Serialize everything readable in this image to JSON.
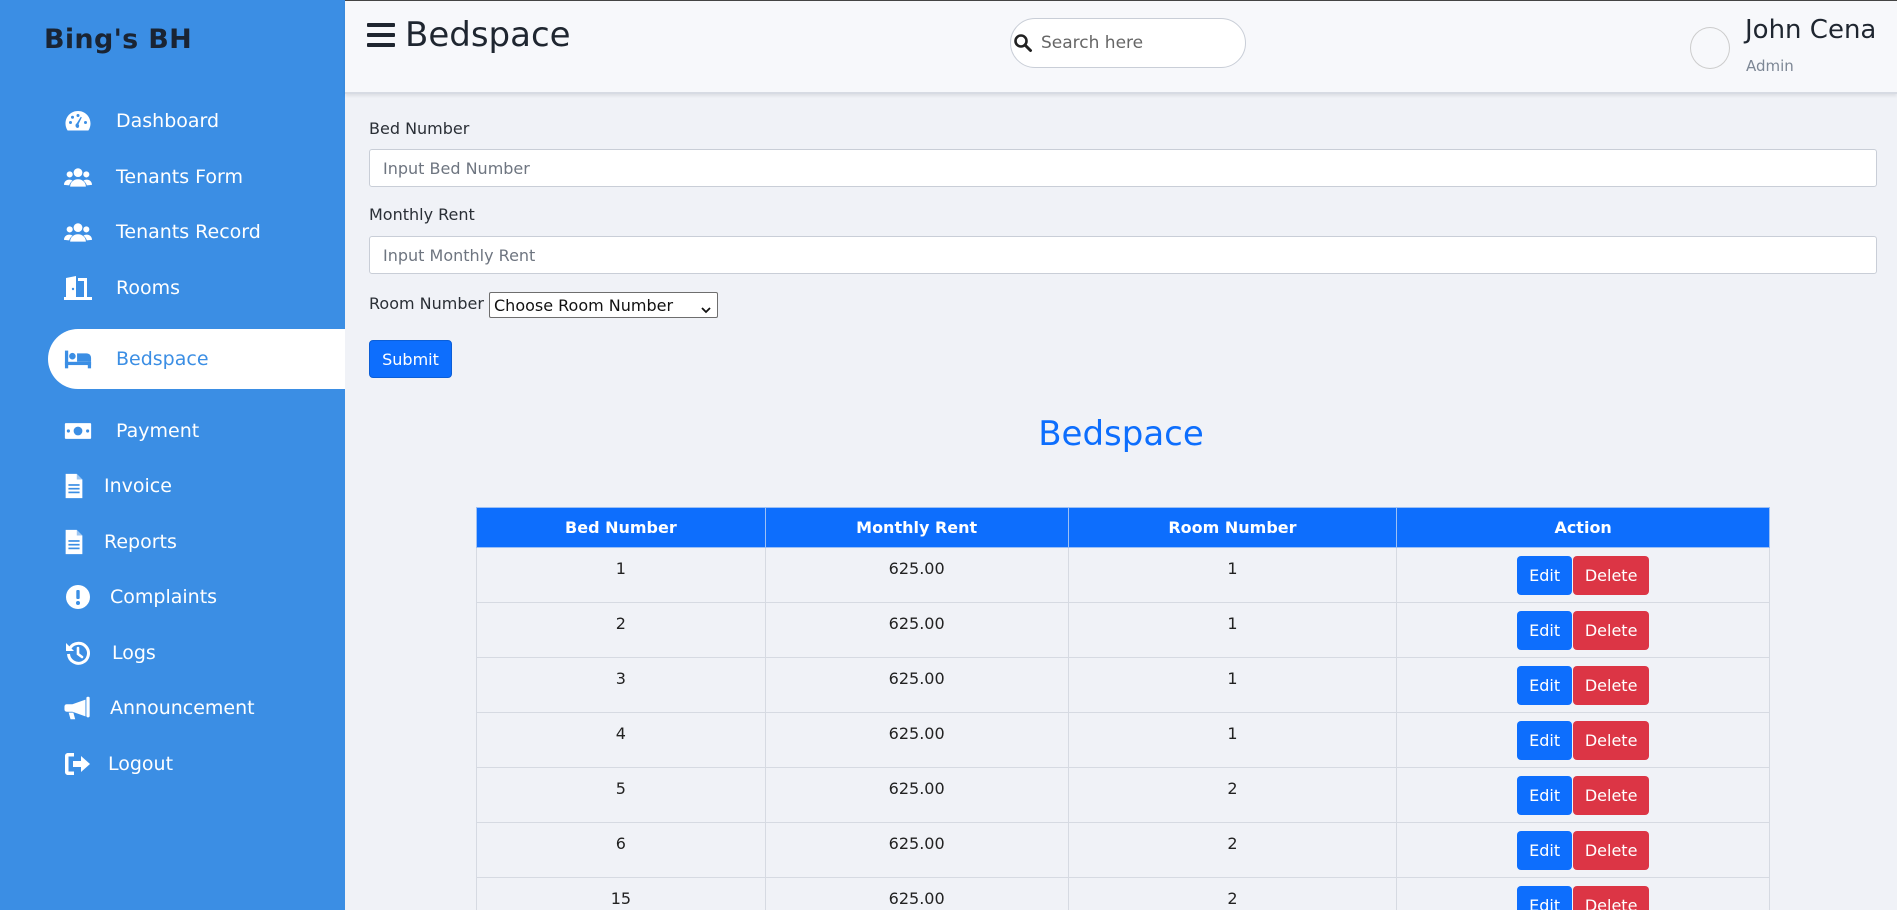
{
  "sidebar": {
    "brand": "Bing's BH",
    "items": [
      {
        "label": "Dashboard",
        "icon": "gauge-icon"
      },
      {
        "label": "Tenants Form",
        "icon": "users-icon"
      },
      {
        "label": "Tenants Record",
        "icon": "users-icon"
      },
      {
        "label": "Rooms",
        "icon": "door-icon"
      },
      {
        "label": "Bedspace",
        "icon": "bed-icon",
        "active": true
      },
      {
        "label": "Payment",
        "icon": "money-icon"
      },
      {
        "label": "Invoice",
        "icon": "file-icon"
      },
      {
        "label": "Reports",
        "icon": "file-icon"
      },
      {
        "label": "Complaints",
        "icon": "exclamation-icon"
      },
      {
        "label": "Logs",
        "icon": "history-icon"
      },
      {
        "label": "Announcement",
        "icon": "megaphone-icon"
      },
      {
        "label": "Logout",
        "icon": "sign-out-icon"
      }
    ]
  },
  "header": {
    "title": "Bedspace",
    "search_placeholder": "Search here",
    "user_name": "John Cena",
    "user_role": "Admin"
  },
  "form": {
    "bed_number_label": "Bed Number",
    "bed_number_placeholder": "Input Bed Number",
    "monthly_rent_label": "Monthly Rent",
    "monthly_rent_placeholder": "Input Monthly Rent",
    "room_number_label": "Room Number",
    "room_number_selected": "Choose Room Number",
    "submit_label": "Submit"
  },
  "table": {
    "title": "Bedspace",
    "headers": [
      "Bed Number",
      "Monthly Rent",
      "Room Number",
      "Action"
    ],
    "edit_label": "Edit",
    "delete_label": "Delete",
    "rows": [
      {
        "bed": "1",
        "rent": "625.00",
        "room": "1"
      },
      {
        "bed": "2",
        "rent": "625.00",
        "room": "1"
      },
      {
        "bed": "3",
        "rent": "625.00",
        "room": "1"
      },
      {
        "bed": "4",
        "rent": "625.00",
        "room": "1"
      },
      {
        "bed": "5",
        "rent": "625.00",
        "room": "2"
      },
      {
        "bed": "6",
        "rent": "625.00",
        "room": "2"
      },
      {
        "bed": "15",
        "rent": "625.00",
        "room": "2"
      }
    ]
  },
  "colors": {
    "sidebar_bg": "#3b8ee4",
    "primary": "#0d6efd",
    "danger": "#dc3545"
  }
}
